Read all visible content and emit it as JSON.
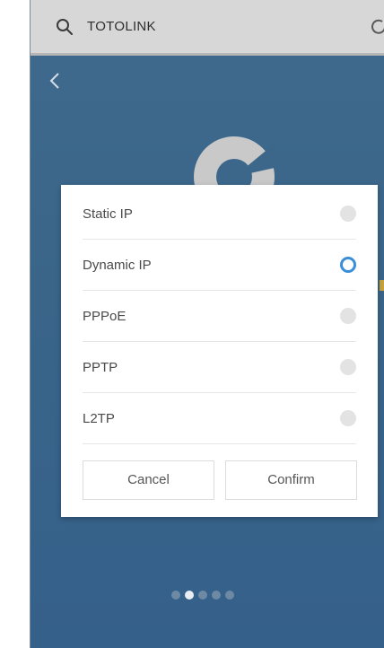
{
  "search": {
    "text": "TOTOLINK"
  },
  "dialog": {
    "options": [
      {
        "label": "Static IP",
        "selected": false
      },
      {
        "label": "Dynamic IP",
        "selected": true
      },
      {
        "label": "PPPoE",
        "selected": false
      },
      {
        "label": "PPTP",
        "selected": false
      },
      {
        "label": "L2TP",
        "selected": false
      }
    ],
    "cancel_label": "Cancel",
    "confirm_label": "Confirm"
  },
  "pager": {
    "total": 5,
    "active_index": 1
  },
  "colors": {
    "background": "#3a6589",
    "selected_radio": "#3a8fd8",
    "unselected_radio": "#e3e3e3",
    "search_bar": "#d7d7d7"
  },
  "icons": {
    "search": "search-icon",
    "refresh": "refresh-icon",
    "back": "chevron-left-icon",
    "logo": "app-logo-icon"
  }
}
